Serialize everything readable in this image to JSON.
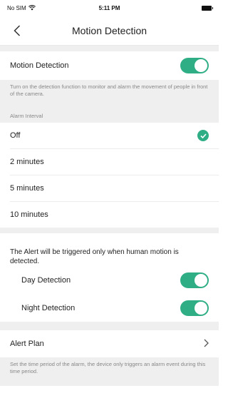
{
  "status_bar": {
    "carrier": "No SIM",
    "time": "5:11 PM"
  },
  "nav": {
    "title": "Motion Detection"
  },
  "motion_detection": {
    "label": "Motion Detection",
    "enabled": true,
    "description": "Turn on the detection function to monitor and alarm the movement of people in front of the camera."
  },
  "alarm_interval": {
    "section_label": "Alarm Interval",
    "options": [
      "Off",
      "2 minutes",
      "5 minutes",
      "10 minutes"
    ],
    "selected": "Off"
  },
  "human_alert": {
    "note": "The Alert will be triggered only when human motion is detected.",
    "day_label": "Day Detection",
    "day_enabled": true,
    "night_label": "Night Detection",
    "night_enabled": true
  },
  "alert_plan": {
    "label": "Alert Plan",
    "description": "Set the time period of the alarm, the device only triggers an alarm event during this time period."
  },
  "colors": {
    "accent": "#2fae86",
    "section_bg": "#efefef"
  },
  "icons": {
    "back": "chevron-left-icon",
    "check": "check-icon",
    "chevron": "chevron-right-icon",
    "wifi": "wifi-icon",
    "battery": "battery-icon"
  }
}
